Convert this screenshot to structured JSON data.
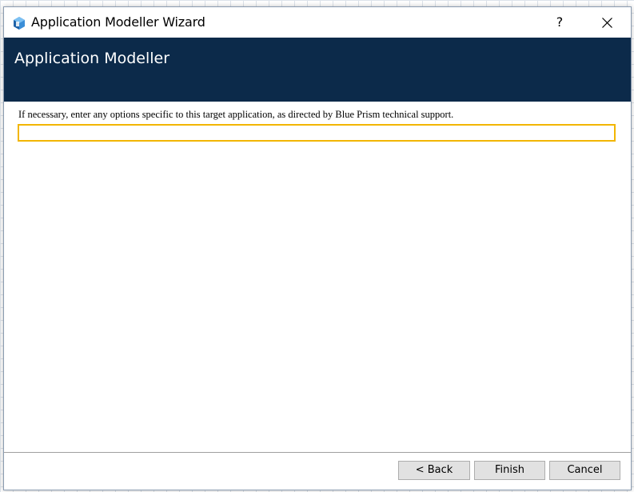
{
  "window": {
    "title": "Application Modeller Wizard",
    "help_glyph": "?",
    "icons": [
      "app-icon",
      "help-icon",
      "close-icon"
    ]
  },
  "header": {
    "title": "Application Modeller",
    "band_color": "#0c2a4a"
  },
  "main": {
    "instruction": "If necessary, enter any options specific to this target application, as directed by Blue Prism technical support.",
    "options_value": "",
    "focus_color": "#f2b600"
  },
  "footer": {
    "back_label": "< Back",
    "finish_label": "Finish",
    "cancel_label": "Cancel"
  }
}
